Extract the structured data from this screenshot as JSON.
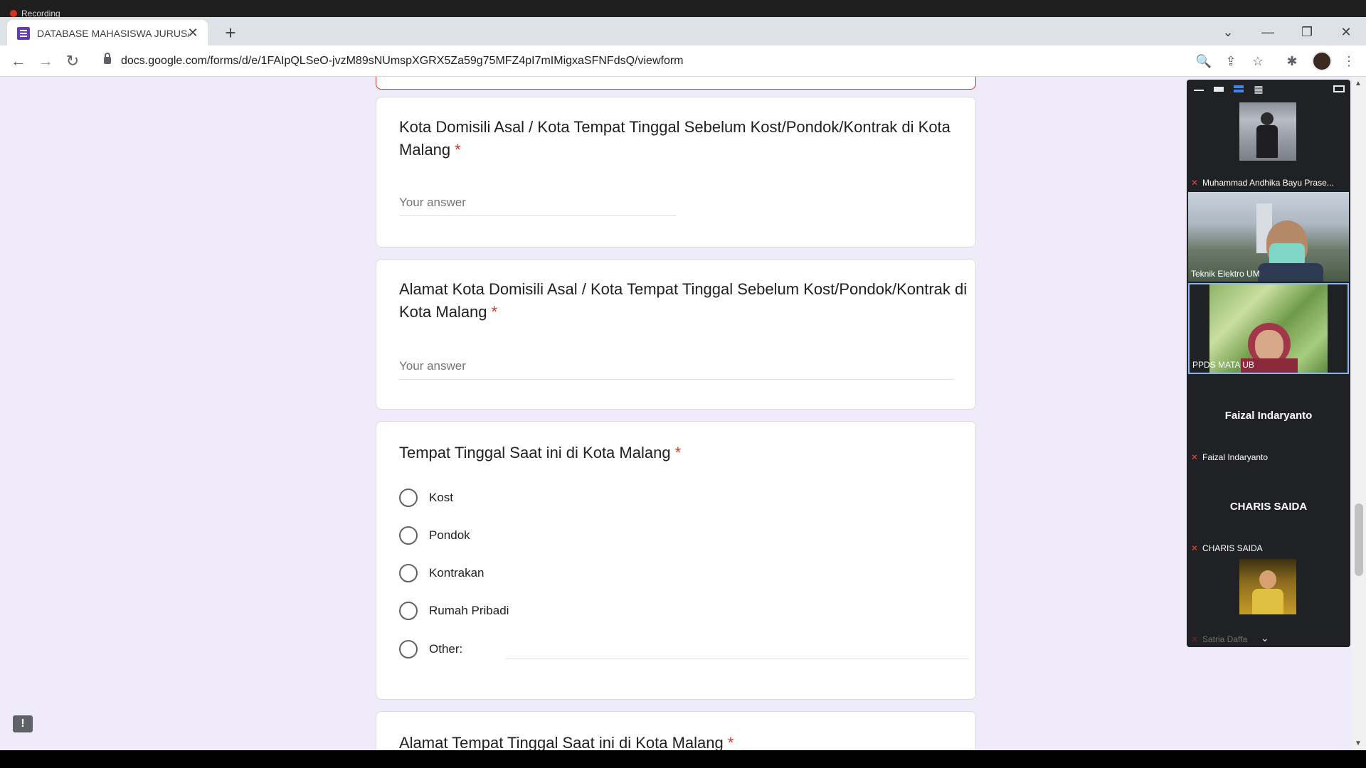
{
  "recording": {
    "label": "Recording"
  },
  "browser": {
    "tab_title": "DATABASE MAHASISWA JURUSA",
    "tab_close": "✕",
    "new_tab": "+",
    "url": "docs.google.com/forms/d/e/1FAIpQLSeO-jvzM89sNUmspXGRX5Za59g75MFZ4pI7mIMigxaSFNFdsQ/viewform",
    "window_controls": {
      "dropdown": "⌄",
      "minimize": "—",
      "restore": "❐",
      "close": "✕"
    },
    "nav": {
      "back": "←",
      "forward": "→",
      "reload": "↻"
    },
    "icons": {
      "zoom": "🔍",
      "share": "⇪",
      "bookmark": "☆",
      "extensions": "✱",
      "menu": "⋮"
    }
  },
  "form": {
    "required_mark": "*",
    "questions": [
      {
        "title_line1": "Kota Domisili Asal / Kota Tempat Tinggal Sebelum Kost/Pondok/Kontrak di Kota",
        "title_line2": "Malang",
        "placeholder": "Your answer"
      },
      {
        "title_line1": "Alamat Kota Domisili Asal / Kota Tempat Tinggal Sebelum Kost/Pondok/Kontrak di",
        "title_line2": "Kota Malang",
        "placeholder": "Your answer"
      },
      {
        "title": "Tempat Tinggal Saat ini di Kota Malang",
        "options": [
          "Kost",
          "Pondok",
          "Kontrakan",
          "Rumah Pribadi",
          "Other:"
        ]
      },
      {
        "title": "Alamat Tempat Tinggal Saat ini di Kota Malang"
      }
    ],
    "feedback": "!"
  },
  "meeting": {
    "toolbar_icons": [
      "minimize-view-icon",
      "speaker-view-icon",
      "strip-view-icon",
      "gallery-view-icon",
      "pip-icon"
    ],
    "participants": [
      {
        "name": "Muhammad Andhika Bayu Prase...",
        "muted": true,
        "video": true
      },
      {
        "name": "Teknik Elektro UM",
        "muted": false,
        "video": true
      },
      {
        "name": "PPDS MATA UB",
        "muted": false,
        "video": true
      },
      {
        "name": "Faizal Indaryanto",
        "display_name": "Faizal Indaryanto",
        "muted": true,
        "video": false
      },
      {
        "name": "CHARIS SAIDA",
        "display_name": "CHARIS SAIDA",
        "muted": true,
        "video": false
      },
      {
        "name": "Satria Daffa",
        "muted": true,
        "video": true
      }
    ],
    "more": "⌄"
  },
  "colors": {
    "form_bg": "#f0ebf8",
    "accent": "#673ab7",
    "required": "#d93025",
    "meet_bg": "#202124"
  }
}
